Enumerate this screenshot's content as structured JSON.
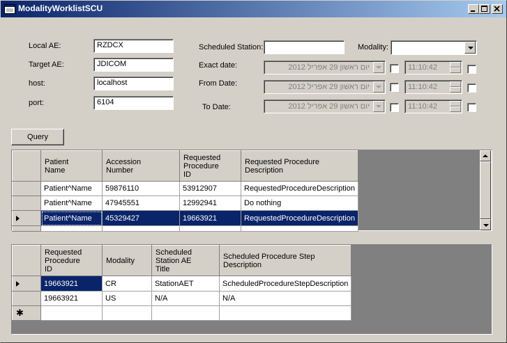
{
  "window": {
    "title": "ModalityWorklistSCU"
  },
  "form": {
    "local_ae_label": "Local AE:",
    "local_ae_value": "RZDCX",
    "target_ae_label": "Target AE:",
    "target_ae_value": "JDICOM",
    "host_label": "host:",
    "host_value": "localhost",
    "port_label": "port:",
    "port_value": "6104",
    "scheduled_station_label": "Scheduled Station:",
    "scheduled_station_value": "",
    "modality_label": "Modality:",
    "modality_value": "",
    "exact_date_label": "Exact date:",
    "from_date_label": "From Date:",
    "to_date_label": "To Date:",
    "date_value": "יום ראשון  29  אפריל  2012",
    "time_value": "11:10:42"
  },
  "query_button": "Query",
  "worklist": {
    "headers": [
      "Patient\nName",
      "Accession\nNumber",
      "Requested\nProcedure\nID",
      "Requested Procedure\nDescription"
    ],
    "rows": [
      [
        "Patient^Name",
        "59876110",
        "53912907",
        "RequestedProcedureDescription"
      ],
      [
        "Patient^Name",
        "47945551",
        "12992941",
        "Do nothing"
      ],
      [
        "Patient^Name",
        "45329427",
        "19663921",
        "RequestedProcedureDescription"
      ]
    ],
    "selected_row": 2
  },
  "steps": {
    "headers": [
      "Requested\nProcedure\nID",
      "Modality",
      "Scheduled\nStation AE\nTitle",
      "Scheduled Procedure Step\nDescription"
    ],
    "rows": [
      [
        "19663921",
        "CR",
        "StationAET",
        "ScheduledProcedureStepDescription"
      ],
      [
        "19663921",
        "US",
        "N/A",
        "N/A"
      ]
    ]
  },
  "colors": {
    "titlebar_start": "#0a246a",
    "titlebar_end": "#a6caf0",
    "selection": "#0a246a",
    "face": "#d4d0c8"
  }
}
